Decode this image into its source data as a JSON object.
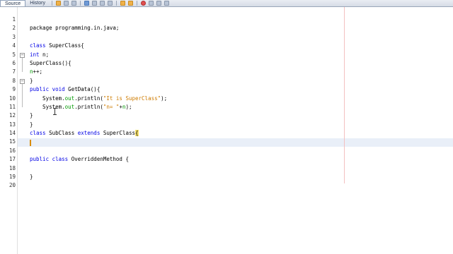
{
  "tabs": {
    "source": "Source",
    "history": "History"
  },
  "toolbar": {
    "icons": [
      "last-edit-icon",
      "back-icon",
      "forward-icon",
      "find-icon",
      "prev-occurrence-icon",
      "next-occurrence-icon",
      "toggle-highlight-icon",
      "shift-left-icon",
      "shift-right-icon",
      "start-macro-icon",
      "stop-macro-icon",
      "comment-icon",
      "uncomment-icon"
    ]
  },
  "line_numbers": [
    "1",
    "2",
    "3",
    "4",
    "5",
    "6",
    "7",
    "8",
    "9",
    "10",
    "11",
    "12",
    "13",
    "14",
    "15",
    "16",
    "17",
    "18",
    "19",
    "20"
  ],
  "code": {
    "l1": "",
    "l2": "package programming.in.java;",
    "l3": "",
    "l4_kw": "class",
    "l4_rest": " SuperClass{",
    "l5_kw": "int",
    "l5_rest": " n;",
    "l6": "SuperClass(){",
    "l7_fld": "n",
    "l7_rest": "++;",
    "l8": "}",
    "l9_kw": "public void",
    "l9_rest": " GetData(){",
    "l10_pre": "    System.",
    "l10_fld": "out",
    "l10_mid": ".println(",
    "l10_str": "\"It is SuperClass\"",
    "l10_end": ");",
    "l11_pre": "    System.",
    "l11_fld": "out",
    "l11_mid": ".println(",
    "l11_str": "\"n= \"",
    "l11_plus": "+",
    "l11_fld2": "n",
    "l11_end": ");",
    "l12": "}",
    "l13": "}",
    "l14_kw1": "class",
    "l14_name": " SubClass ",
    "l14_kw2": "extends",
    "l14_rest": " SuperClass",
    "l14_brace": "{",
    "l15": "",
    "l16": "",
    "l17_kw": "public class",
    "l17_rest": " OverriddenMethod {",
    "l18": "",
    "l19": "}",
    "l20": ""
  },
  "colors": {
    "keyword": "#0000e6",
    "string": "#ce7b00",
    "field": "#009900",
    "highlight": "#f6e06a"
  }
}
